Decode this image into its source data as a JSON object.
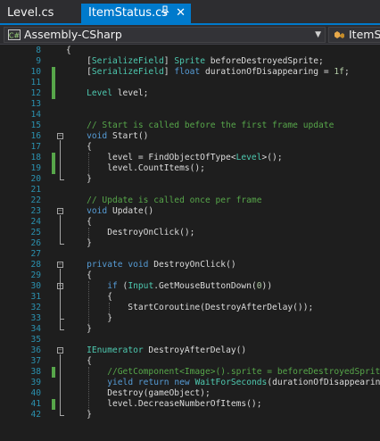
{
  "tabs": [
    {
      "label": "Level.cs",
      "active": false
    },
    {
      "label": "ItemStatus.cs",
      "active": true,
      "pin_icon": "pin-icon",
      "close_icon": "close-icon"
    }
  ],
  "nav": {
    "project": "Assembly-CSharp",
    "member": "ItemSt"
  },
  "colors": {
    "keyword": "#569cd6",
    "type": "#4ec9b0",
    "comment": "#57a64a",
    "number": "#b5cea8",
    "text": "#dcdcdc",
    "line_number": "#2b91af",
    "change_saved": "#57a64a",
    "change_unsaved": "#efef00",
    "accent": "#007acc"
  },
  "lines": [
    {
      "n": "8",
      "change": "",
      "fold": "",
      "tokens": [
        [
          "{",
          "t"
        ]
      ]
    },
    {
      "n": "9",
      "change": "",
      "fold": "",
      "tokens": [
        [
          "    [",
          "t"
        ],
        [
          "SerializeField",
          "ty"
        ],
        [
          "] ",
          "t"
        ],
        [
          "Sprite",
          "ty"
        ],
        [
          " beforeDestroyedSprite;",
          "t"
        ]
      ]
    },
    {
      "n": "10",
      "change": "saved",
      "fold": "",
      "tokens": [
        [
          "    [",
          "t"
        ],
        [
          "SerializeField",
          "ty"
        ],
        [
          "] ",
          "t"
        ],
        [
          "float",
          "k"
        ],
        [
          " durationOfDisappearing = ",
          "t"
        ],
        [
          "1f",
          "n"
        ],
        [
          ";",
          "t"
        ]
      ]
    },
    {
      "n": "11",
      "change": "saved",
      "fold": "",
      "tokens": []
    },
    {
      "n": "12",
      "change": "saved",
      "fold": "",
      "tokens": [
        [
          "    ",
          "t"
        ],
        [
          "Level",
          "ty"
        ],
        [
          " level;",
          "t"
        ]
      ]
    },
    {
      "n": "13",
      "change": "",
      "fold": "",
      "tokens": []
    },
    {
      "n": "14",
      "change": "",
      "fold": "",
      "tokens": []
    },
    {
      "n": "15",
      "change": "",
      "fold": "",
      "tokens": [
        [
          "    // Start is called before the first frame update",
          "c"
        ]
      ]
    },
    {
      "n": "16",
      "change": "",
      "fold": "minus",
      "tokens": [
        [
          "    ",
          "t"
        ],
        [
          "void",
          "k"
        ],
        [
          " Start()",
          "t"
        ]
      ]
    },
    {
      "n": "17",
      "change": "",
      "fold": "",
      "tokens": [
        [
          "    {",
          "t"
        ]
      ]
    },
    {
      "n": "18",
      "change": "saved",
      "fold": "",
      "tokens": [
        [
          "        level = FindObjectOfType<",
          "t"
        ],
        [
          "Level",
          "ty"
        ],
        [
          ">();",
          "t"
        ]
      ]
    },
    {
      "n": "19",
      "change": "saved",
      "fold": "",
      "tokens": [
        [
          "        level.CountItems();",
          "t"
        ]
      ]
    },
    {
      "n": "20",
      "change": "",
      "fold": "",
      "tokens": [
        [
          "    }",
          "t"
        ]
      ]
    },
    {
      "n": "21",
      "change": "",
      "fold": "",
      "tokens": []
    },
    {
      "n": "22",
      "change": "",
      "fold": "",
      "tokens": [
        [
          "    // Update is called once per frame",
          "c"
        ]
      ]
    },
    {
      "n": "23",
      "change": "",
      "fold": "minus",
      "tokens": [
        [
          "    ",
          "t"
        ],
        [
          "void",
          "k"
        ],
        [
          " Update()",
          "t"
        ]
      ]
    },
    {
      "n": "24",
      "change": "",
      "fold": "",
      "tokens": [
        [
          "    {",
          "t"
        ]
      ]
    },
    {
      "n": "25",
      "change": "",
      "fold": "",
      "tokens": [
        [
          "        DestroyOnClick();",
          "t"
        ]
      ]
    },
    {
      "n": "26",
      "change": "",
      "fold": "",
      "tokens": [
        [
          "    }",
          "t"
        ]
      ]
    },
    {
      "n": "27",
      "change": "",
      "fold": "",
      "tokens": []
    },
    {
      "n": "28",
      "change": "",
      "fold": "minus",
      "tokens": [
        [
          "    ",
          "t"
        ],
        [
          "private",
          "k"
        ],
        [
          " ",
          "t"
        ],
        [
          "void",
          "k"
        ],
        [
          " DestroyOnClick()",
          "t"
        ]
      ]
    },
    {
      "n": "29",
      "change": "",
      "fold": "",
      "tokens": [
        [
          "    {",
          "t"
        ]
      ]
    },
    {
      "n": "30",
      "change": "",
      "fold": "minus",
      "tokens": [
        [
          "        ",
          "t"
        ],
        [
          "if",
          "k"
        ],
        [
          " (",
          "t"
        ],
        [
          "Input",
          "ty"
        ],
        [
          ".GetMouseButtonDown(",
          "t"
        ],
        [
          "0",
          "n"
        ],
        [
          "))",
          "t"
        ]
      ]
    },
    {
      "n": "31",
      "change": "",
      "fold": "",
      "tokens": [
        [
          "        {",
          "t"
        ]
      ]
    },
    {
      "n": "32",
      "change": "",
      "fold": "",
      "tokens": [
        [
          "            StartCoroutine(DestroyAfterDelay());",
          "t"
        ]
      ]
    },
    {
      "n": "33",
      "change": "",
      "fold": "",
      "tokens": [
        [
          "        }",
          "t"
        ]
      ]
    },
    {
      "n": "34",
      "change": "",
      "fold": "",
      "tokens": [
        [
          "    }",
          "t"
        ]
      ]
    },
    {
      "n": "35",
      "change": "",
      "fold": "",
      "tokens": []
    },
    {
      "n": "36",
      "change": "",
      "fold": "minus",
      "tokens": [
        [
          "    ",
          "t"
        ],
        [
          "IEnumerator",
          "ty"
        ],
        [
          " DestroyAfterDelay()",
          "t"
        ]
      ]
    },
    {
      "n": "37",
      "change": "",
      "fold": "",
      "tokens": [
        [
          "    {",
          "t"
        ]
      ]
    },
    {
      "n": "38",
      "change": "saved",
      "fold": "",
      "tokens": [
        [
          "        //GetComponent<Image>().sprite = beforeDestroyedSprite;",
          "c"
        ]
      ]
    },
    {
      "n": "39",
      "change": "",
      "fold": "",
      "tokens": [
        [
          "        ",
          "t"
        ],
        [
          "yield",
          "k"
        ],
        [
          " ",
          "t"
        ],
        [
          "return",
          "k"
        ],
        [
          " ",
          "t"
        ],
        [
          "new",
          "k"
        ],
        [
          " ",
          "t"
        ],
        [
          "WaitForSeconds",
          "ty"
        ],
        [
          "(durationOfDisappearing);",
          "t"
        ]
      ]
    },
    {
      "n": "40",
      "change": "",
      "fold": "",
      "tokens": [
        [
          "        Destroy(gameObject);",
          "t"
        ]
      ]
    },
    {
      "n": "41",
      "change": "saved",
      "fold": "",
      "tokens": [
        [
          "        level.DecreaseNumberOfItems();",
          "t"
        ]
      ]
    },
    {
      "n": "42",
      "change": "",
      "fold": "",
      "tokens": [
        [
          "    }",
          "t"
        ]
      ]
    }
  ]
}
